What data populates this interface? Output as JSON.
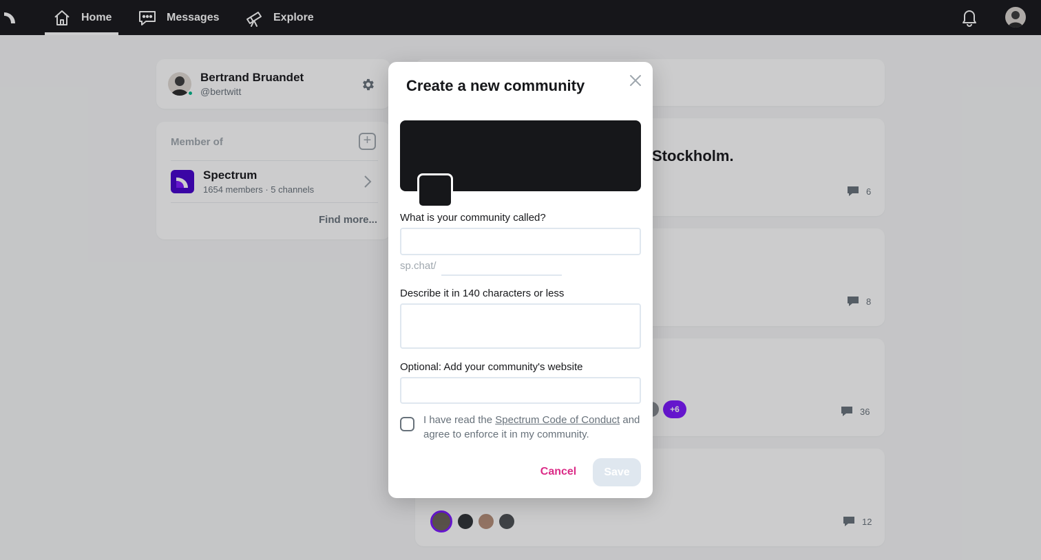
{
  "nav": {
    "tabs": [
      {
        "label": "Home",
        "icon": "home-icon",
        "active": true
      },
      {
        "label": "Messages",
        "icon": "message-icon"
      },
      {
        "label": "Explore",
        "icon": "telescope-icon"
      }
    ]
  },
  "profile": {
    "name": "Bertrand Bruandet",
    "handle": "@bertwitt",
    "status_color": "#00b88b"
  },
  "member_of": {
    "title": "Member of",
    "communities": [
      {
        "name": "Spectrum",
        "meta": "1654 members · 5 channels",
        "logo_color": "#4400cc"
      }
    ],
    "find_more": "Find more..."
  },
  "feed": {
    "threads": [
      {
        "title_fragment": "Stockholm.",
        "comment_count": "6"
      },
      {
        "comment_count": "8"
      },
      {
        "comment_count": "36",
        "extra_participants": "+6"
      },
      {
        "comment_count": "12"
      }
    ]
  },
  "modal": {
    "title": "Create a new community",
    "name_label": "What is your community called?",
    "name_value": "",
    "slug_prefix": "sp.chat/",
    "slug_value": "",
    "description_label": "Describe it in 140 characters or less",
    "description_value": "",
    "website_label": "Optional: Add your community's website",
    "website_value": "",
    "coc_prefix": "I have read the ",
    "coc_link": "Spectrum Code of Conduct",
    "coc_suffix": " and agree to enforce it in my community.",
    "cancel_label": "Cancel",
    "save_label": "Save"
  },
  "colors": {
    "nav_bg": "#16171a",
    "accent_pink": "#db2b87",
    "brand_purple": "#7b16ff",
    "disabled_button": "#dfe7ef"
  }
}
